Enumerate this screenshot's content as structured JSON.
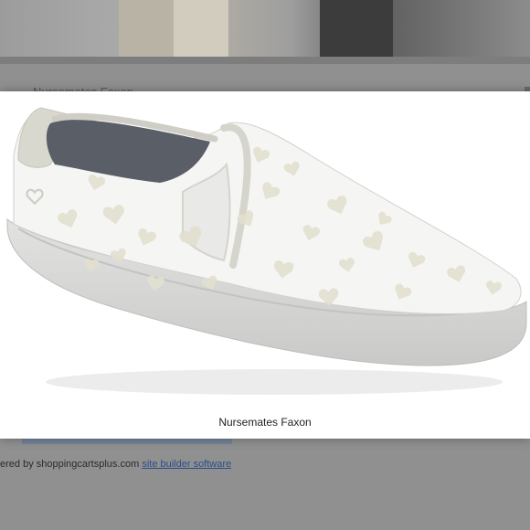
{
  "background": {
    "page_title": "Nursemates Faxon",
    "footer_prefix": "ered by shoppingcartsplus.com ",
    "footer_link": "site builder software"
  },
  "lightbox": {
    "caption": "Nursemates Faxon",
    "image_alt": "White slip-on shoe with heart print"
  },
  "icons": {
    "heart": "heart-icon"
  },
  "colors": {
    "overlay": "#8a8a8a",
    "lightbox_bg": "#ffffff",
    "shoe_body": "#f4f4f2",
    "shoe_trim": "#d6d5cc",
    "sole": "#d2d2d2",
    "link": "#2a4f8a"
  }
}
